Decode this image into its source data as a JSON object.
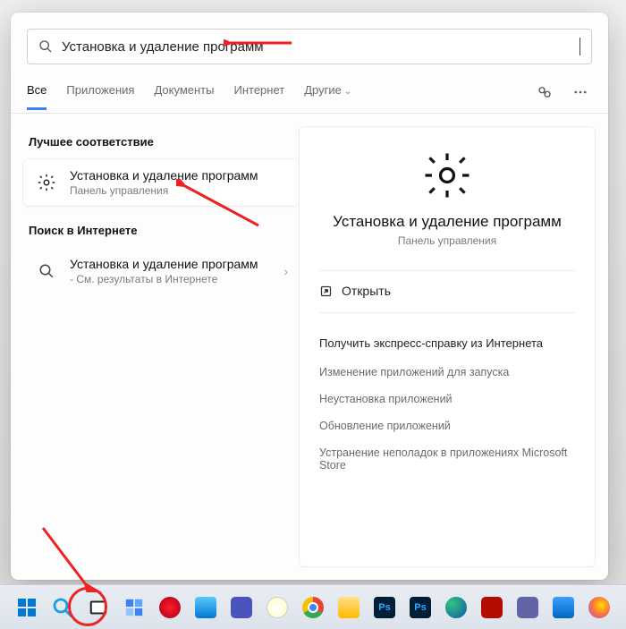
{
  "search": {
    "value": "Установка и удаление программ",
    "placeholder": ""
  },
  "tabs": {
    "all": "Все",
    "apps": "Приложения",
    "docs": "Документы",
    "web": "Интернет",
    "more": "Другие"
  },
  "left": {
    "bestMatchHeader": "Лучшее соответствие",
    "result1": {
      "title": "Установка и удаление программ",
      "sub": "Панель управления"
    },
    "webHeader": "Поиск в Интернете",
    "result2": {
      "title": "Установка и удаление программ",
      "sub": "- См. результаты в Интернете"
    }
  },
  "right": {
    "title": "Установка и удаление программ",
    "sub": "Панель управления",
    "open": "Открыть",
    "helpHeader": "Получить экспресс-справку из Интернета",
    "links": {
      "l1": "Изменение приложений для запуска",
      "l2": "Неустановка приложений",
      "l3": "Обновление приложений",
      "l4": "Устранение неполадок в приложениях Microsoft Store"
    }
  },
  "taskbar": {
    "colors": {
      "start": "#0067c0",
      "search": "#1a9fde",
      "taskview": "#2b2b2b",
      "widgets": "#0078d4",
      "opera": "#c03",
      "mail": "#0078d4",
      "chat": "#4b53bc",
      "paint": "#d83b01",
      "chrome": "#1a73e8",
      "files": "#ffb900",
      "ps": "#001e36",
      "ps2": "#001e36",
      "edge": "#0c59a4",
      "acr": "#b30b00",
      "snip": "#6264a7",
      "photos": "#0078d4",
      "ff": "#ff7139"
    }
  }
}
